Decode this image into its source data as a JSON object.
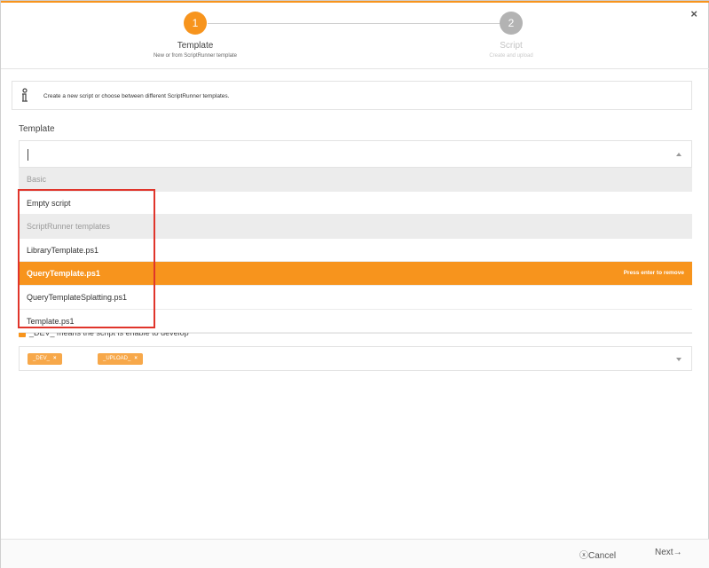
{
  "dialog": {
    "close_icon": "×",
    "accent_color": "#f7941d"
  },
  "wizard": {
    "steps": [
      {
        "number": "1",
        "title": "Template",
        "subtitle": "New or from ScriptRunner template",
        "state": "active"
      },
      {
        "number": "2",
        "title": "Script",
        "subtitle": "Create and upload",
        "state": "inactive"
      }
    ]
  },
  "info": {
    "icon": "info-icon",
    "text": "Create a new script or choose between different ScriptRunner templates."
  },
  "template_field": {
    "label": "Template",
    "value": "",
    "options": [
      {
        "label": "Basic",
        "type": "group"
      },
      {
        "label": "Empty script",
        "type": "option"
      },
      {
        "label": "ScriptRunner templates",
        "type": "group"
      },
      {
        "label": "LibraryTemplate.ps1",
        "type": "option"
      },
      {
        "label": "QueryTemplate.ps1",
        "type": "option",
        "active": true,
        "hint": "Press enter to remove"
      },
      {
        "label": "QueryTemplateSplatting.ps1",
        "type": "option"
      },
      {
        "label": "Template.ps1",
        "type": "option"
      }
    ]
  },
  "dev_checkbox": {
    "checked": true,
    "label": "_DEV_ means the script is enable to develop"
  },
  "tags": {
    "items": [
      "_DEV_",
      "_UPLOAD_"
    ],
    "remove_icon": "×"
  },
  "footer": {
    "cancel_label": "Cancel",
    "cancel_icon": "ⓧ",
    "next_label": "Next",
    "next_icon": "→"
  }
}
